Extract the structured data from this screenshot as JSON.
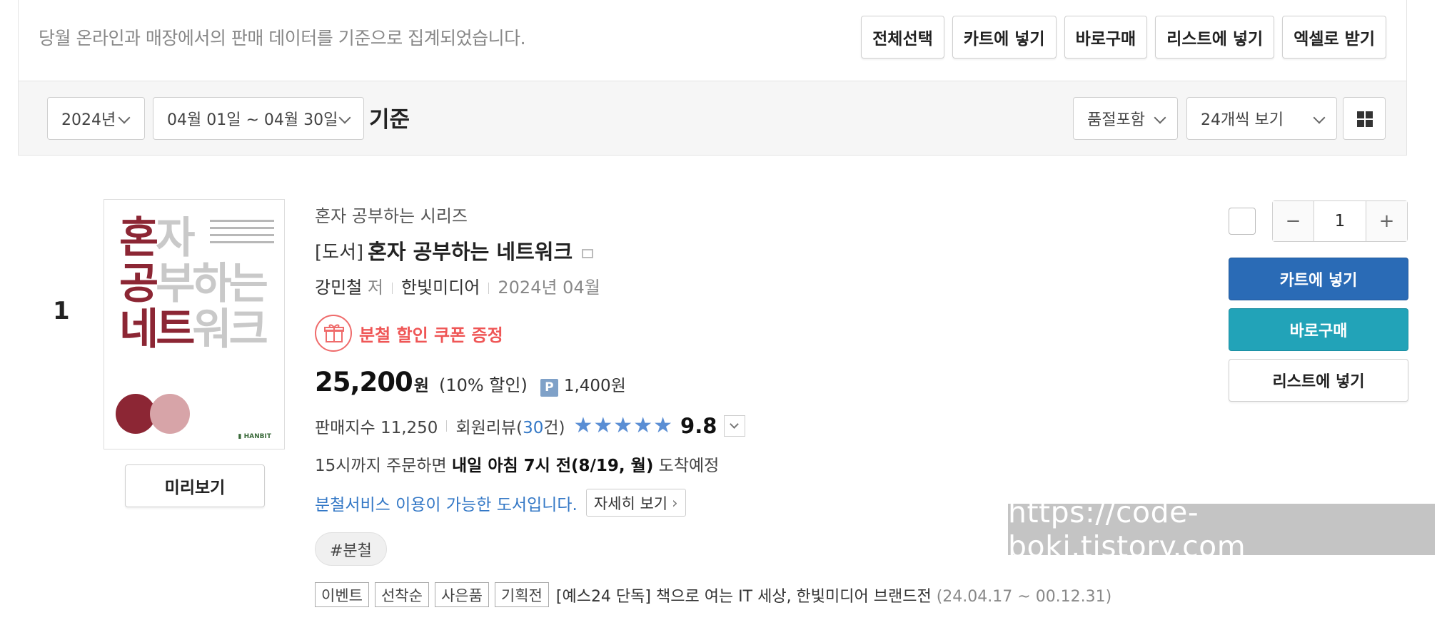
{
  "toolbar": {
    "notice": "당월 온라인과 매장에서의 판매 데이터를 기준으로 집계되었습니다.",
    "select_all": "전체선택",
    "add_cart": "카트에 넣기",
    "buy_now": "바로구매",
    "add_list": "리스트에 넣기",
    "excel": "엑셀로 받기"
  },
  "filters": {
    "year": "2024년",
    "period": "04월 01일 ~ 04월 30일",
    "basis": "기준",
    "stock": "품절포함",
    "per_page": "24개씩 보기",
    "view_mode_icon": "grid-icon"
  },
  "item": {
    "rank": "1",
    "series": "혼자 공부하는 시리즈",
    "category": "[도서]",
    "title": "혼자 공부하는 네트워크",
    "author": "강민철",
    "author_suffix": "저",
    "publisher": "한빛미디어",
    "pub_date": "2024년 04월",
    "coupon": "분철 할인 쿠폰 증정",
    "price": "25,200",
    "price_unit": "원",
    "discount": "(10% 할인)",
    "point_badge": "P",
    "points": "1,400원",
    "sales_index_label": "판매지수 11,250",
    "review_prefix": "회원리뷰(",
    "review_count": "30",
    "review_suffix": "건)",
    "rating_stars": 5,
    "score": "9.8",
    "delivery_prefix": "15시까지 주문하면 ",
    "delivery_bold": "내일 아침 7시 전(8/19, 월)",
    "delivery_suffix": " 도착예정",
    "service_text": "분철서비스 이용이 가능한 도서입니다.",
    "service_more": "자세히 보기",
    "tag": "#분철",
    "event_labels": [
      "이벤트",
      "선착순",
      "사은품",
      "기획전"
    ],
    "event_text": "[예스24 단독] 책으로 여는 IT 세상, 한빛미디어 브랜드전",
    "event_dates": "(24.04.17 ~ 00.12.31)",
    "preview": "미리보기",
    "quantity": "1",
    "cart_button": "카트에 넣기",
    "buy_button": "바로구매",
    "list_button": "리스트에 넣기",
    "cover": {
      "line1_dark": "혼",
      "line1_light": "자",
      "line2_dark": "공",
      "line2_light": "부하는",
      "line3_dark": "네트",
      "line3_light": "워크"
    }
  },
  "watermark": "https://code-boki.tistory.com",
  "colors": {
    "cart_blue": "#2a6bb6",
    "buy_teal": "#22a3b8",
    "coupon_red": "#ef5656",
    "link_blue": "#3478c6",
    "star_blue": "#5a8ed4",
    "cover_red": "#8c2634"
  }
}
